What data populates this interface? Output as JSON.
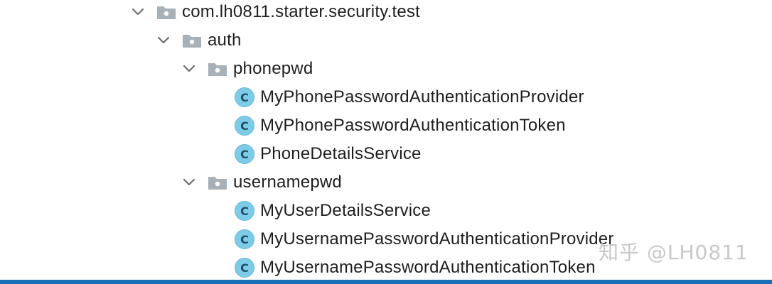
{
  "tree": {
    "root": {
      "label": "com.lh0811.starter.security.test",
      "expanded": true,
      "children": {
        "auth": {
          "label": "auth",
          "expanded": true,
          "phonepwd": {
            "label": "phonepwd",
            "expanded": true,
            "classes": [
              "MyPhonePasswordAuthenticationProvider",
              "MyPhonePasswordAuthenticationToken",
              "PhoneDetailsService"
            ]
          },
          "usernamepwd": {
            "label": "usernamepwd",
            "expanded": true,
            "classes": [
              "MyUserDetailsService",
              "MyUsernamePasswordAuthenticationProvider",
              "MyUsernamePasswordAuthenticationToken"
            ]
          }
        }
      }
    },
    "class_icon_letter": "C",
    "icons": {
      "expand": "chevron-down-icon",
      "folder": "folder-icon",
      "class": "class-icon"
    },
    "colors": {
      "class_icon_bg": "#7dcbe6",
      "folder_icon": "#a8b0b8",
      "chevron": "#6e6e6e",
      "text": "#1e1e1e",
      "bottom_bar": "#1a6fb8"
    }
  },
  "watermark": "知乎 @LH0811"
}
